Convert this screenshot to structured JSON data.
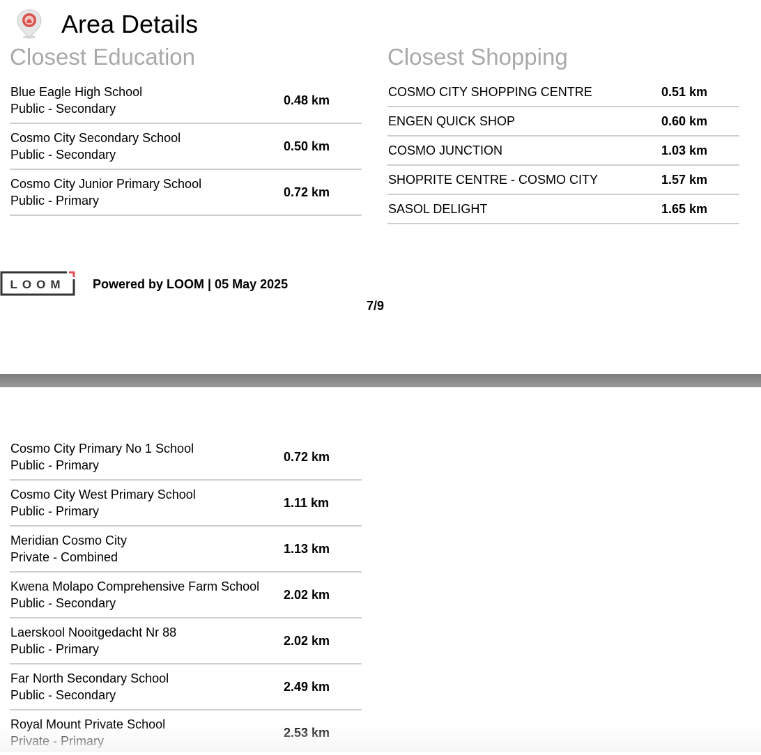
{
  "header": {
    "title": "Area Details",
    "icon": "location-pin-icon",
    "icon_color": "#d9534f"
  },
  "education": {
    "title": "Closest Education",
    "items_page1": [
      {
        "name": "Blue Eagle High School",
        "type": "Public - Secondary",
        "distance": "0.48 km"
      },
      {
        "name": "Cosmo City Secondary School",
        "type": "Public - Secondary",
        "distance": "0.50 km"
      },
      {
        "name": "Cosmo City Junior Primary School",
        "type": "Public - Primary",
        "distance": "0.72 km"
      }
    ],
    "items_page2": [
      {
        "name": "Cosmo City Primary No 1 School",
        "type": "Public - Primary",
        "distance": "0.72 km"
      },
      {
        "name": "Cosmo City West Primary School",
        "type": "Public - Primary",
        "distance": "1.11 km"
      },
      {
        "name": "Meridian Cosmo City",
        "type": "Private - Combined",
        "distance": "1.13 km"
      },
      {
        "name": "Kwena Molapo Comprehensive Farm School",
        "type": "Public - Secondary",
        "distance": "2.02 km"
      },
      {
        "name": "Laerskool Nooitgedacht Nr 88",
        "type": "Public - Primary",
        "distance": "2.02 km"
      },
      {
        "name": "Far North Secondary School",
        "type": "Public - Secondary",
        "distance": "2.49 km"
      },
      {
        "name": "Royal Mount Private School",
        "type": "Private - Primary",
        "distance": "2.53 km"
      }
    ]
  },
  "shopping": {
    "title": "Closest Shopping",
    "items": [
      {
        "name": "COSMO CITY SHOPPING CENTRE",
        "distance": "0.51 km"
      },
      {
        "name": "ENGEN QUICK SHOP",
        "distance": "0.60 km"
      },
      {
        "name": "COSMO JUNCTION",
        "distance": "1.03 km"
      },
      {
        "name": "SHOPRITE CENTRE - COSMO CITY",
        "distance": "1.57 km"
      },
      {
        "name": "SASOL DELIGHT",
        "distance": "1.65 km"
      }
    ]
  },
  "footer": {
    "logo_text": "LOOM",
    "logo_accent_color": "#e8515b",
    "powered_by": "Powered by LOOM | 05 May 2025",
    "page_number": "7/9"
  }
}
